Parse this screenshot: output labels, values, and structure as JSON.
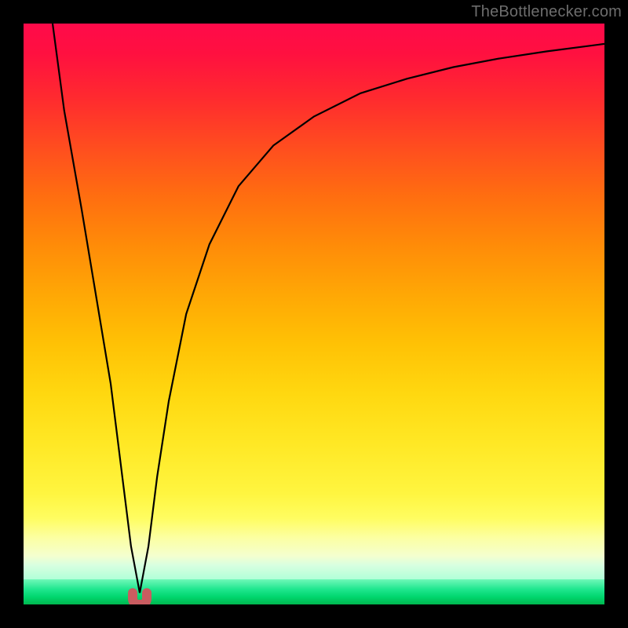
{
  "credit": "TheBottlenecker.com",
  "curve_color": "#000000",
  "marker_color": "#c95c60",
  "chart_data": {
    "type": "line",
    "title": "",
    "xlabel": "",
    "ylabel": "",
    "xlim": [
      0,
      100
    ],
    "ylim": [
      0,
      100
    ],
    "grid": false,
    "series": [
      {
        "name": "curve",
        "x": [
          5,
          7,
          10,
          12,
          15,
          17,
          18.5,
          20,
          21.5,
          23,
          25,
          28,
          32,
          37,
          43,
          50,
          58,
          66,
          74,
          82,
          90,
          100
        ],
        "y": [
          100,
          85,
          68,
          56,
          38,
          22,
          10,
          2,
          10,
          22,
          35,
          50,
          62,
          72,
          79,
          84,
          88,
          90.5,
          92.5,
          94,
          95.2,
          96.5
        ]
      }
    ],
    "marker": {
      "x": 20,
      "y_top": 2,
      "y_bottom": 0,
      "shape": "U"
    },
    "background": {
      "type": "vertical-gradient",
      "stops": [
        "#ff0a4a",
        "#ffa805",
        "#fffd60",
        "#00b84f"
      ]
    }
  }
}
